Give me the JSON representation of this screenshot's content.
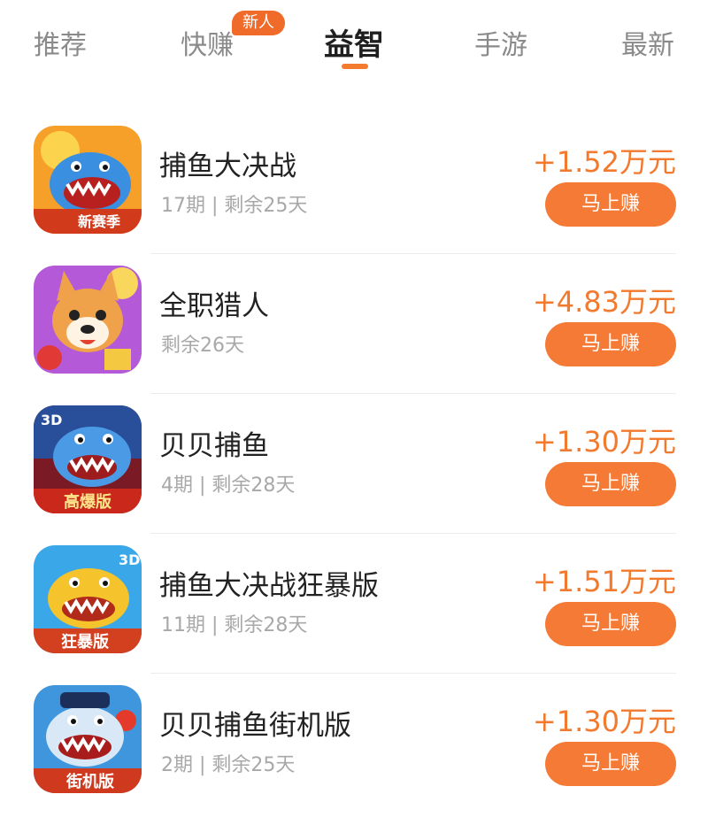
{
  "tabs": [
    {
      "label": "推荐"
    },
    {
      "label": "快赚",
      "badge": "新人"
    },
    {
      "label": "益智",
      "active": true
    },
    {
      "label": "手游"
    },
    {
      "label": "最新"
    }
  ],
  "earn_label": "马上赚",
  "games": [
    {
      "name": "捕鱼大决战",
      "meta": "17期 | 剩余25天",
      "amount": "+1.52万元",
      "icon": "shark-icon",
      "icon_caption": "新赛季"
    },
    {
      "name": "全职猎人",
      "meta": "剩余26天",
      "amount": "+4.83万元",
      "icon": "shiba-dog-icon"
    },
    {
      "name": "贝贝捕鱼",
      "meta": "4期 | 剩余28天",
      "amount": "+1.30万元",
      "icon": "blue-shark-icon",
      "icon_caption": "高爆版",
      "icon_corner": "3D"
    },
    {
      "name": "捕鱼大决战狂暴版",
      "meta": "11期 | 剩余28天",
      "amount": "+1.51万元",
      "icon": "yellow-shark-icon",
      "icon_caption": "狂暴版",
      "icon_corner": "3D"
    },
    {
      "name": "贝贝捕鱼街机版",
      "meta": "2期 | 剩余25天",
      "amount": "+1.30万元",
      "icon": "shark-chef-icon",
      "icon_caption": "街机版"
    }
  ],
  "colors": {
    "accent": "#f57a35",
    "amount": "#f27a2e",
    "badge": "#f06a2a"
  }
}
